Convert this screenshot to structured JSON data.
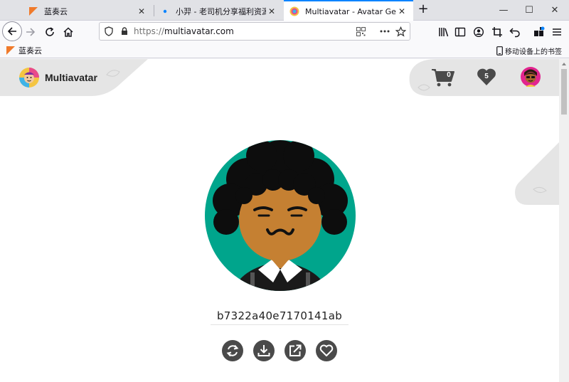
{
  "browser": {
    "tabs": [
      {
        "label": "蓝奏云",
        "icon": "lanzou-icon",
        "selected": false
      },
      {
        "label": "小羿 - 老司机分享福利资源，福",
        "icon": "dot-icon",
        "selected": false
      },
      {
        "label": "Multiavatar - Avatar Generator",
        "icon": "multiavatar-icon",
        "selected": true
      }
    ],
    "new_tab": "+",
    "window_controls": {
      "minimize": "—",
      "maximize": "☐",
      "close": "✕"
    },
    "url": {
      "protocol": "https://",
      "host": "multiavatar.com"
    },
    "bookmarks": [
      {
        "label": "蓝奏云"
      }
    ],
    "mobile_bookmarks": "移动设备上的书签"
  },
  "site": {
    "brand": "Multiavatar",
    "cart_count": "0",
    "favorites_count": "5",
    "avatar_hash": "b7322a40e7170141ab",
    "actions": [
      "refresh-icon",
      "download-icon",
      "share-icon",
      "heart-icon"
    ],
    "colors": {
      "accent_bg": "#e5e5e5",
      "action_bg": "#4a4a4a",
      "avatar_bg": "#00a58c",
      "skin": "#c58032"
    }
  }
}
